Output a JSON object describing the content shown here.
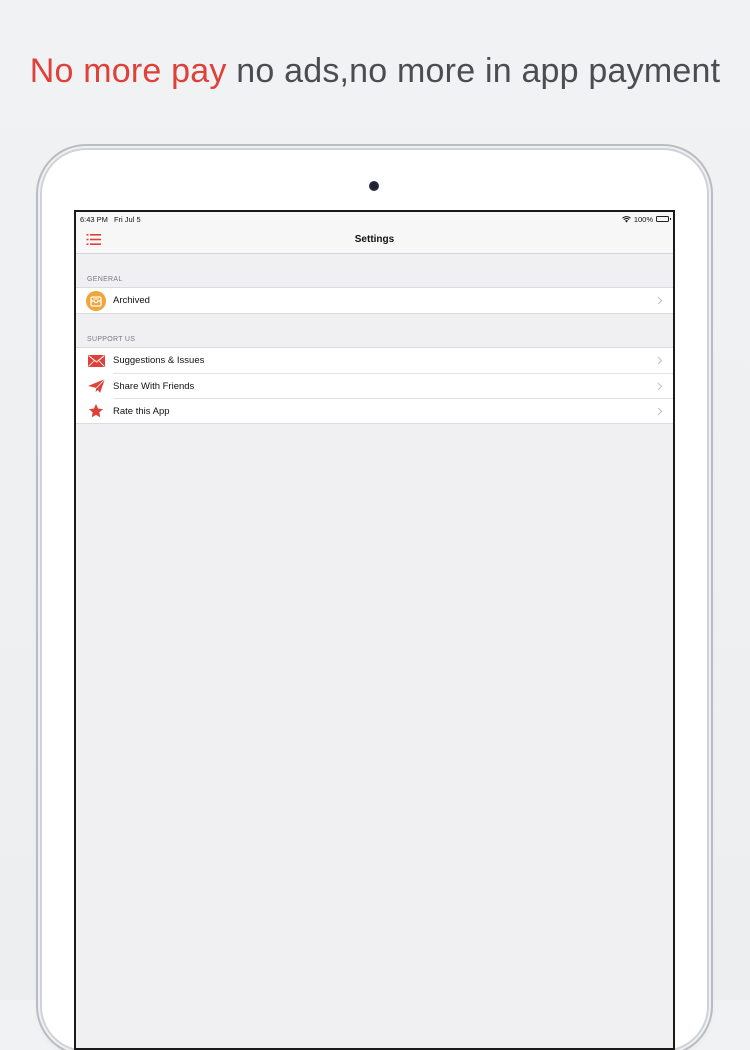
{
  "headline": {
    "accent_text": "No more pay",
    "rest_text": " no ads,no more in app payment"
  },
  "status_bar": {
    "time": "6:43 PM",
    "date": "Fri Jul 5",
    "battery": "100%",
    "battery_level": 1.0
  },
  "nav": {
    "title": "Settings",
    "menu_icon": "list-menu-icon"
  },
  "sections": {
    "general": {
      "header": "GENERAL",
      "items": [
        {
          "label": "Archived",
          "icon": "archive-box-icon"
        }
      ]
    },
    "support": {
      "header": "SUPPORT US",
      "items": [
        {
          "label": "Suggestions & Issues",
          "icon": "envelope-icon"
        },
        {
          "label": "Share With Friends",
          "icon": "paper-plane-icon"
        },
        {
          "label": "Rate this App",
          "icon": "star-icon"
        }
      ]
    }
  },
  "colors": {
    "accent": "#e0403a",
    "archive_orange": "#f0a53a",
    "headline_gray": "#4a4d52"
  }
}
